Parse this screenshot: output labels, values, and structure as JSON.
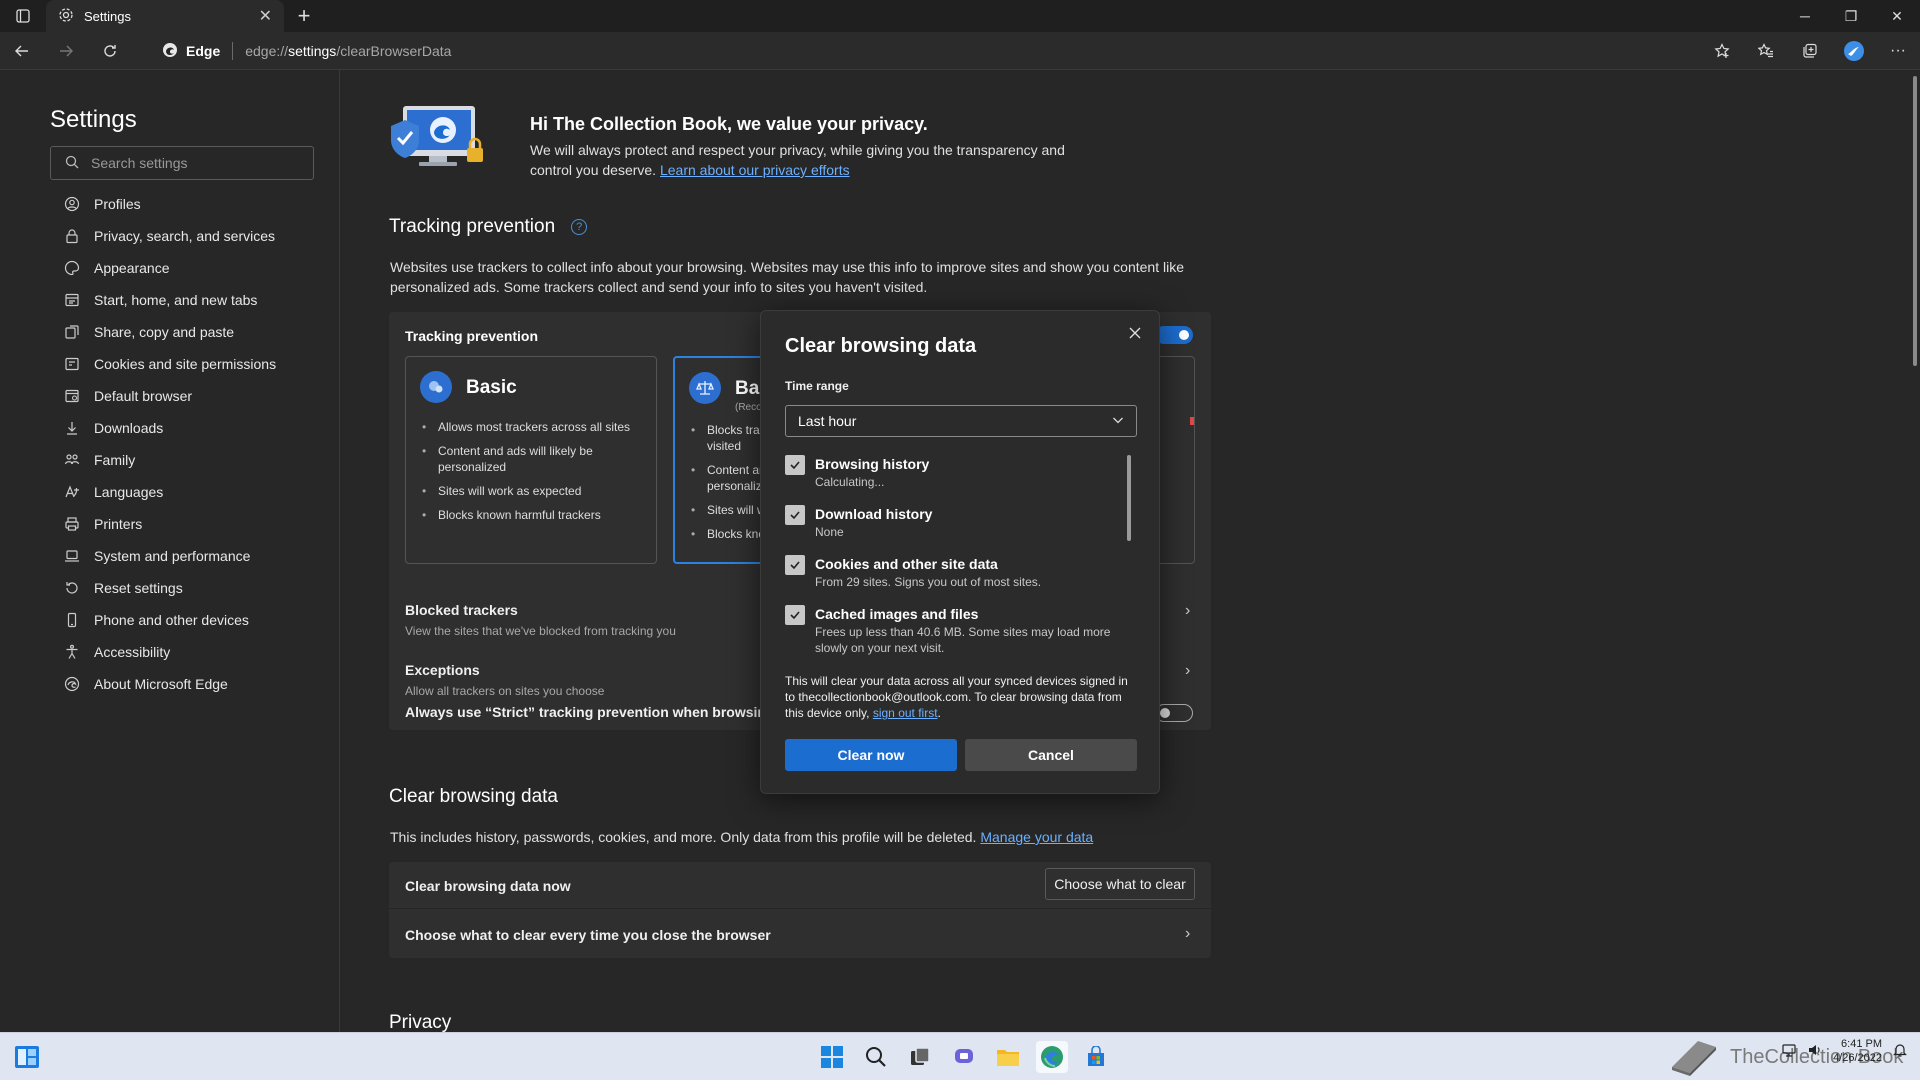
{
  "browser": {
    "tab_title": "Settings",
    "address_badge": "Edge",
    "url_prefix": "edge://",
    "url_host": "settings",
    "url_path": "/clearBrowserData"
  },
  "sidebar": {
    "title": "Settings",
    "search_placeholder": "Search settings",
    "items": [
      {
        "label": "Profiles",
        "icon": "profile-icon"
      },
      {
        "label": "Privacy, search, and services",
        "icon": "lock-icon"
      },
      {
        "label": "Appearance",
        "icon": "palette-icon"
      },
      {
        "label": "Start, home, and new tabs",
        "icon": "home-icon"
      },
      {
        "label": "Share, copy and paste",
        "icon": "share-icon"
      },
      {
        "label": "Cookies and site permissions",
        "icon": "cookie-icon"
      },
      {
        "label": "Default browser",
        "icon": "browser-icon"
      },
      {
        "label": "Downloads",
        "icon": "download-icon"
      },
      {
        "label": "Family",
        "icon": "family-icon"
      },
      {
        "label": "Languages",
        "icon": "language-icon"
      },
      {
        "label": "Printers",
        "icon": "printer-icon"
      },
      {
        "label": "System and performance",
        "icon": "laptop-icon"
      },
      {
        "label": "Reset settings",
        "icon": "reset-icon"
      },
      {
        "label": "Phone and other devices",
        "icon": "phone-icon"
      },
      {
        "label": "Accessibility",
        "icon": "accessibility-icon"
      },
      {
        "label": "About Microsoft Edge",
        "icon": "edge-icon"
      }
    ]
  },
  "hero": {
    "title": "Hi The Collection Book, we value your privacy.",
    "text": "We will always protect and respect your privacy, while giving you the transparency and control you deserve.",
    "link": "Learn about our privacy efforts"
  },
  "tracking": {
    "heading": "Tracking prevention",
    "help": "?",
    "description": "Websites use trackers to collect info about your browsing. Websites may use this info to improve sites and show you content like personalized ads. Some trackers collect and send your info to sites you haven't visited.",
    "card_title": "Tracking prevention",
    "basic": {
      "title": "Basic",
      "bullets": [
        "Allows most trackers across all sites",
        "Content and ads will likely be personalized",
        "Sites will work as expected",
        "Blocks known harmful trackers"
      ]
    },
    "balanced": {
      "title": "Bal",
      "sub": "(Reco",
      "bullets": [
        "Blocks trac",
        "visited",
        "Content ar",
        "personaliz",
        "Sites will w",
        "Blocks kno"
      ]
    },
    "blocked_title": "Blocked trackers",
    "blocked_sub": "View the sites that we've blocked from tracking you",
    "exceptions_title": "Exceptions",
    "exceptions_sub": "Allow all trackers on sites you choose",
    "strict_label": "Always use “Strict” tracking prevention when browsing I"
  },
  "clear_section": {
    "heading": "Clear browsing data",
    "description": "This includes history, passwords, cookies, and more. Only data from this profile will be deleted.",
    "link": "Manage your data",
    "row1_label": "Clear browsing data now",
    "row1_button": "Choose what to clear",
    "row2_label": "Choose what to clear every time you close the browser"
  },
  "privacy_heading": "Privacy",
  "modal": {
    "title": "Clear browsing data",
    "time_range_label": "Time range",
    "time_range_value": "Last hour",
    "items": [
      {
        "title": "Browsing history",
        "sub": "Calculating..."
      },
      {
        "title": "Download history",
        "sub": "None"
      },
      {
        "title": "Cookies and other site data",
        "sub": "From 29 sites. Signs you out of most sites."
      },
      {
        "title": "Cached images and files",
        "sub": "Frees up less than 40.6 MB. Some sites may load more slowly on your next visit."
      }
    ],
    "note": "This will clear your data across all your synced devices signed in to thecollectionbook@outlook.com. To clear browsing data from this device only,",
    "note_link": "sign out first",
    "note_end": ".",
    "primary": "Clear now",
    "secondary": "Cancel"
  },
  "taskbar": {
    "watermark": "TheCollection Book",
    "time": "6:41 PM",
    "date": "4/26/2022"
  },
  "colors": {
    "accent": "#1c6dd0",
    "link": "#6cb0ff",
    "background": "#272727"
  }
}
